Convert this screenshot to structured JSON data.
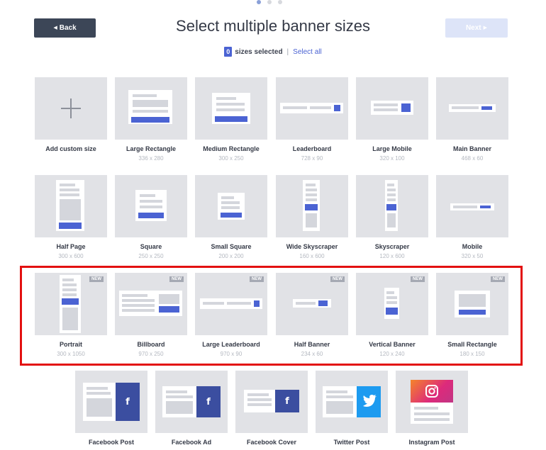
{
  "header": {
    "title": "Select multiple banner sizes",
    "back_label": "Back",
    "next_label": "Next",
    "selected_count": "0",
    "selected_text": "sizes selected",
    "select_all_label": "Select all"
  },
  "pagination": {
    "total": 3,
    "active": 1
  },
  "colors": {
    "accent": "#4b63d3",
    "highlight": "#e31010",
    "dark_button": "#3c4657"
  },
  "badge_label": "NEW",
  "banners": [
    {
      "name": "Add custom size",
      "dims": ""
    },
    {
      "name": "Large Rectangle",
      "dims": "336 x 280"
    },
    {
      "name": "Medium Rectangle",
      "dims": "300 x 250"
    },
    {
      "name": "Leaderboard",
      "dims": "728 x 90"
    },
    {
      "name": "Large Mobile",
      "dims": "320 x 100"
    },
    {
      "name": "Main Banner",
      "dims": "468 x 60"
    },
    {
      "name": "Half Page",
      "dims": "300 x 600"
    },
    {
      "name": "Square",
      "dims": "250 x 250"
    },
    {
      "name": "Small Square",
      "dims": "200 x 200"
    },
    {
      "name": "Wide Skyscraper",
      "dims": "160 x 600"
    },
    {
      "name": "Skyscraper",
      "dims": "120 x 600"
    },
    {
      "name": "Mobile",
      "dims": "320 x 50"
    },
    {
      "name": "Portrait",
      "dims": "300 x 1050",
      "is_new": true
    },
    {
      "name": "Billboard",
      "dims": "970 x 250",
      "is_new": true
    },
    {
      "name": "Large Leaderboard",
      "dims": "970 x 90",
      "is_new": true
    },
    {
      "name": "Half Banner",
      "dims": "234 x 60",
      "is_new": true
    },
    {
      "name": "Vertical Banner",
      "dims": "120 x 240",
      "is_new": true
    },
    {
      "name": "Small Rectangle",
      "dims": "180 x 150",
      "is_new": true
    }
  ],
  "social": [
    {
      "name": "Facebook Post",
      "icon": "facebook-icon"
    },
    {
      "name": "Facebook Ad",
      "icon": "facebook-icon"
    },
    {
      "name": "Facebook Cover",
      "icon": "facebook-icon"
    },
    {
      "name": "Twitter Post",
      "icon": "twitter-icon"
    },
    {
      "name": "Instagram Post",
      "icon": "instagram-icon"
    }
  ]
}
